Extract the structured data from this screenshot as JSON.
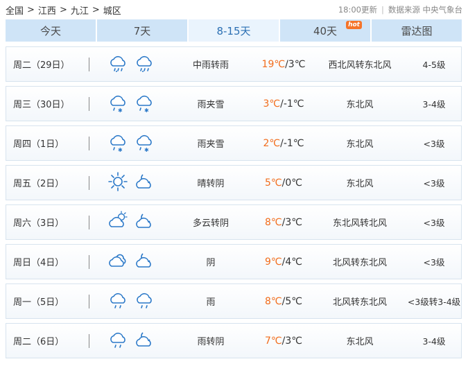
{
  "breadcrumb": {
    "items": [
      "全国",
      "江西",
      "九江",
      "城区"
    ],
    "separator": ">"
  },
  "source": {
    "update_time": "18:00更新",
    "source_text": "数据来源 中央气象台"
  },
  "tabs": [
    {
      "label": "今天",
      "active": false
    },
    {
      "label": "7天",
      "active": false
    },
    {
      "label": "8-15天",
      "active": true
    },
    {
      "label": "40天",
      "active": false,
      "badge": "hot"
    },
    {
      "label": "雷达图",
      "active": false
    }
  ],
  "colors": {
    "accent": "#2b6fb3",
    "tab_bg": "#cfe4f7",
    "tab_active_bg": "#eaf4fd",
    "high_temp": "#f26c1b",
    "hot_badge": "#f5742a",
    "icon_stroke": "#2a78c8"
  },
  "forecast": [
    {
      "day": "周二（29日）",
      "icon_day": "rain-icon",
      "icon_night": "rain-icon",
      "weather": "中雨转雨",
      "high": "19℃",
      "low": "/3℃",
      "wind": "西北风转东北风",
      "level": "4-5级"
    },
    {
      "day": "周三（30日）",
      "icon_day": "sleet-icon",
      "icon_night": "sleet-icon",
      "weather": "雨夹雪",
      "high": "3℃",
      "low": "/-1℃",
      "wind": "东北风",
      "level": "3-4级"
    },
    {
      "day": "周四（1日）",
      "icon_day": "sleet-icon",
      "icon_night": "sleet-icon",
      "weather": "雨夹雪",
      "high": "2℃",
      "low": "/-1℃",
      "wind": "东北风",
      "level": "<3级"
    },
    {
      "day": "周五（2日）",
      "icon_day": "sun-icon",
      "icon_night": "cloudy-moon-icon",
      "weather": "晴转阴",
      "high": "5℃",
      "low": "/0℃",
      "wind": "东北风",
      "level": "<3级"
    },
    {
      "day": "周六（3日）",
      "icon_day": "partly-cloudy-icon",
      "icon_night": "cloudy-moon-icon",
      "weather": "多云转阴",
      "high": "8℃",
      "low": "/3℃",
      "wind": "东北风转北风",
      "level": "<3级"
    },
    {
      "day": "周日（4日）",
      "icon_day": "overcast-icon",
      "icon_night": "cloudy-moon-icon",
      "weather": "阴",
      "high": "9℃",
      "low": "/4℃",
      "wind": "北风转东北风",
      "level": "<3级"
    },
    {
      "day": "周一（5日）",
      "icon_day": "light-rain-icon",
      "icon_night": "light-rain-icon",
      "weather": "雨",
      "high": "8℃",
      "low": "/5℃",
      "wind": "北风转东北风",
      "level": "<3级转3-4级"
    },
    {
      "day": "周二（6日）",
      "icon_day": "light-rain-icon",
      "icon_night": "cloudy-moon-icon",
      "weather": "雨转阴",
      "high": "7℃",
      "low": "/3℃",
      "wind": "东北风",
      "level": "3-4级"
    }
  ]
}
